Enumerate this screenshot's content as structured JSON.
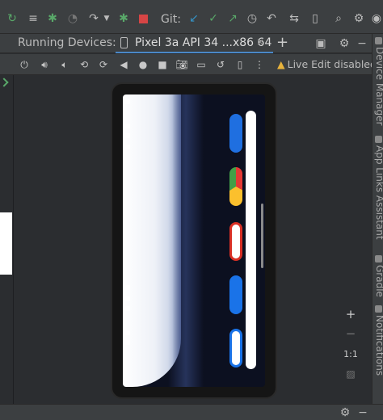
{
  "toolbar": {
    "git_label": "Git:",
    "icons": [
      "run-app-icon",
      "tasks-icon",
      "debug-icon",
      "profiler-icon",
      "apply-changes-icon",
      "attach-debugger-icon",
      "stop-icon",
      "git-update-icon",
      "git-commit-icon",
      "git-push-icon",
      "history-icon",
      "rollback-icon",
      "device-manager-icon",
      "device-mirror-icon",
      "search-icon",
      "settings-icon",
      "avatar-icon"
    ]
  },
  "tabs": {
    "running_devices": "Running Devices:",
    "device_tab": "Pixel 3a API 34 ...x86 64",
    "close": "×",
    "add": "+"
  },
  "controls": {
    "live_edit": "Live Edit disabled",
    "warn_glyph": "▲"
  },
  "right_tabs": {
    "device_manager": "Device Manager",
    "app_links": "App Links Assistant",
    "gradle": "Gradle",
    "notifications": "Notifications"
  },
  "zoom": {
    "zoom_in": "+",
    "zoom_out": "−",
    "actual_size": "1:1"
  },
  "colors": {
    "accent": "#4a88c7",
    "green": "#59a869",
    "stop_red": "#d64545",
    "warning": "#e8b33c",
    "blue_check": "#3592c4"
  }
}
